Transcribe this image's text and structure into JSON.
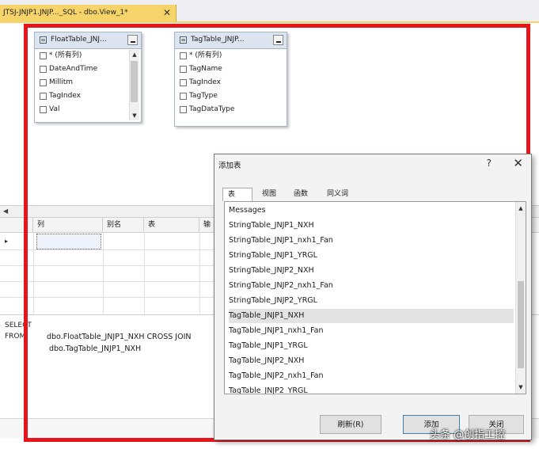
{
  "document_tab": {
    "title": "JTSJ-JNJP1.JNJP..._SQL - dbo.View_1*",
    "close": "✕"
  },
  "diagram": {
    "tables": [
      {
        "title": "FloatTable_JNJ...",
        "columns": [
          "* (所有列)",
          "DateAndTime",
          "Millitm",
          "TagIndex",
          "Val"
        ]
      },
      {
        "title": "TagTable_JNJP...",
        "columns": [
          "* (所有列)",
          "TagName",
          "TagIndex",
          "TagType",
          "TagDataType"
        ]
      }
    ]
  },
  "grid": {
    "headers": [
      "列",
      "别名",
      "表",
      "输"
    ],
    "row_marker": "▸"
  },
  "sql": {
    "keywords": [
      "SELECT",
      "FROM"
    ],
    "from_line1": "dbo.FloatTable_JNJP1_NXH CROSS JOIN",
    "from_line2": "dbo.TagTable_JNJP1_NXH"
  },
  "dialog": {
    "title": "添加表",
    "help": "?",
    "close": "✕",
    "tabs": [
      "表",
      "视图",
      "函数",
      "同义词"
    ],
    "active_tab": "表",
    "items": [
      "Messages",
      "StringTable_JNJP1_NXH",
      "StringTable_JNJP1_nxh1_Fan",
      "StringTable_JNJP1_YRGL",
      "StringTable_JNJP2_NXH",
      "StringTable_JNJP2_nxh1_Fan",
      "StringTable_JNJP2_YRGL",
      "TagTable_JNJP1_NXH",
      "TagTable_JNJP1_nxh1_Fan",
      "TagTable_JNJP1_YRGL",
      "TagTable_JNJP2_NXH",
      "TagTable_JNJP2_nxh1_Fan",
      "TagTable_JNJP2_YRGL"
    ],
    "selected_item": "TagTable_JNJP1_NXH",
    "buttons": {
      "refresh": "刷新(R)",
      "add": "添加",
      "close": "关闭"
    }
  },
  "watermark": {
    "text": "头条 @创指工控"
  },
  "colors": {
    "highlight_frame": "#e6151b",
    "doc_tab": "#f7d46a"
  }
}
